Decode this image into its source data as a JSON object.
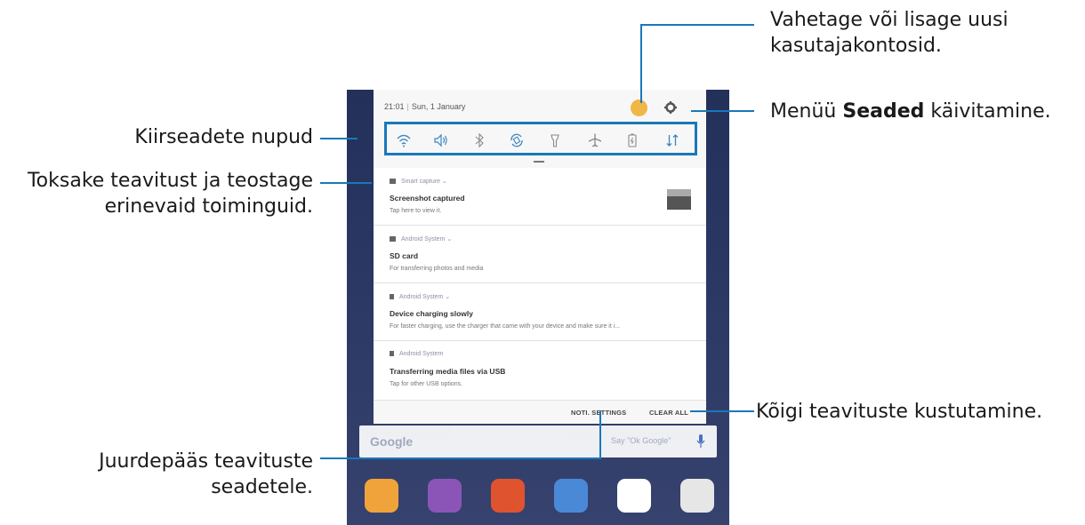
{
  "annotations": {
    "accounts": [
      "Vahetage või lisage uusi",
      "kasutajakontosid."
    ],
    "settings_prefix": "Menüü",
    "settings_bold": "Seaded",
    "settings_suffix": "käivitamine.",
    "quick_buttons": "Kiirseadete nupud",
    "tap_notification": [
      "Toksake teavitust ja teostage",
      "erinevaid toiminguid."
    ],
    "clear_all": "Kõigi teavituste kustutamine.",
    "notif_settings_access": [
      "Juurdepääs teavituste",
      "seadetele."
    ]
  },
  "colors": {
    "accent": "#1a78b9",
    "avatar": "#f0b648"
  },
  "panel": {
    "time": "21:01",
    "date": "Sun, 1 January",
    "quick_settings": [
      "wifi-icon",
      "sound-icon",
      "bluetooth-icon",
      "auto-rotate-icon",
      "flashlight-icon",
      "airplane-icon",
      "power-saving-icon",
      "mobile-data-icon"
    ],
    "notifications": [
      {
        "app": "Smart capture",
        "title": "Screenshot captured",
        "text": "Tap here to view it."
      },
      {
        "app": "Android System",
        "title": "SD card",
        "text": "For transferring photos and media"
      },
      {
        "app": "Android System",
        "title": "Device charging slowly",
        "text": "For faster charging, use the charger that came with your device and make sure it i..."
      },
      {
        "app": "Android System",
        "title": "Transferring media files via USB",
        "text": "Tap for other USB options."
      }
    ],
    "actions": {
      "notif_settings": "NOTI. SETTINGS",
      "clear_all": "CLEAR ALL"
    }
  },
  "home": {
    "search_logo": "Google",
    "search_hint": "Say \"Ok Google\"",
    "apps": [
      "bixby-app-icon",
      "camera-app-icon",
      "notes-app-icon",
      "maps-app-icon",
      "play-store-app-icon",
      "apps-folder-icon"
    ]
  }
}
